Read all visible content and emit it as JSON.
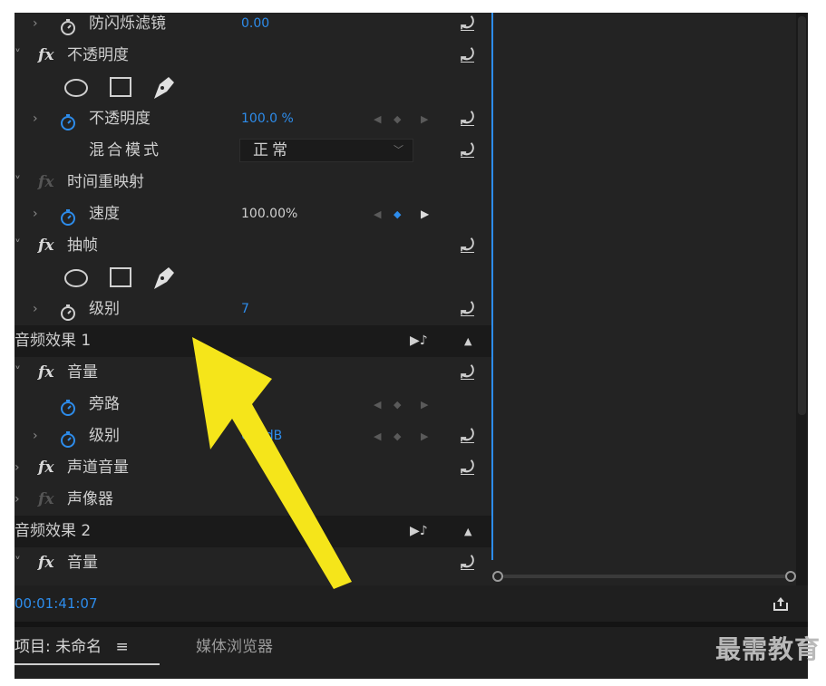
{
  "effects_rows": [
    {
      "type": "param",
      "chevron": "›",
      "label": "防闪烁滤镜",
      "value": "0.00",
      "value_blue": true,
      "reset": "⤾"
    },
    {
      "type": "fx",
      "chevron": "˅",
      "label": "不透明度",
      "reset": "⤾"
    },
    {
      "type": "mask_tools"
    },
    {
      "type": "param",
      "chevron": "›",
      "stopwatch_active": true,
      "label": "不透明度",
      "value": "100.0 %",
      "value_blue": true,
      "keyframes": true,
      "reset": "⤾"
    },
    {
      "type": "select",
      "label": "混合模式",
      "select_value": "正常",
      "reset": "⤾"
    },
    {
      "type": "fx",
      "chevron": "˅",
      "dim": true,
      "label": "时间重映射"
    },
    {
      "type": "param",
      "chevron": "›",
      "stopwatch_active": true,
      "label": "速度",
      "value": "100.00%",
      "keyframes": true,
      "kf_active": true
    },
    {
      "type": "fx",
      "chevron": "˅",
      "label": "抽帧",
      "reset": "⤾"
    },
    {
      "type": "mask_tools"
    },
    {
      "type": "param",
      "chevron": "›",
      "label": "级别",
      "value": "7",
      "value_blue": true,
      "reset": "⤾"
    },
    {
      "type": "section",
      "label": "音频效果 1"
    },
    {
      "type": "fx",
      "chevron": "˅",
      "label": "音量",
      "reset": "⤾"
    },
    {
      "type": "param",
      "chevron": "",
      "stopwatch_active": true,
      "label": "旁路",
      "value": "",
      "keyframes": true
    },
    {
      "type": "param",
      "chevron": "›",
      "stopwatch_active": true,
      "label": "级别",
      "value": "0.0 dB",
      "value_blue": true,
      "keyframes": true,
      "reset": "⤾"
    },
    {
      "type": "fx",
      "chevron": "›",
      "label": "声道音量",
      "reset": "⤾"
    },
    {
      "type": "fx",
      "chevron": "›",
      "dim": true,
      "label": "声像器"
    },
    {
      "type": "section",
      "label": "音频效果 2"
    },
    {
      "type": "fx",
      "chevron": "˅",
      "label": "音量",
      "reset": "⤾"
    }
  ],
  "timecode": "00:01:41:07",
  "tabs": {
    "project": "项目: 未命名",
    "project_menu": "≡",
    "media_browser": "媒体浏览器"
  },
  "watermark": "最需教育",
  "colors": {
    "accent": "#2d8ceb",
    "arrow": "#f5e51a",
    "panel": "#232323"
  }
}
